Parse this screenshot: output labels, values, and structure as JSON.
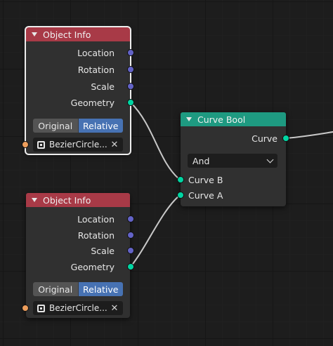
{
  "colors": {
    "input_header": "#a83a47",
    "geometry_header": "#1e9a81",
    "vector_socket": "#6363c7",
    "geometry_socket": "#00d6a3",
    "object_socket": "#ed9e5c",
    "active_toggle": "#4772b3"
  },
  "nodes": {
    "object_info_1": {
      "title": "Object Info",
      "outputs": [
        "Location",
        "Rotation",
        "Scale",
        "Geometry"
      ],
      "transform_modes": [
        "Original",
        "Relative"
      ],
      "active_mode": "Relative",
      "object": "BezierCircle...",
      "clear_glyph": "✕"
    },
    "object_info_2": {
      "title": "Object Info",
      "outputs": [
        "Location",
        "Rotation",
        "Scale",
        "Geometry"
      ],
      "transform_modes": [
        "Original",
        "Relative"
      ],
      "active_mode": "Relative",
      "object": "BezierCircle...",
      "clear_glyph": "✕"
    },
    "curve_bool": {
      "title": "Curve Bool",
      "output": "Curve",
      "operation": "And",
      "inputs": [
        "Curve B",
        "Curve A"
      ]
    }
  }
}
